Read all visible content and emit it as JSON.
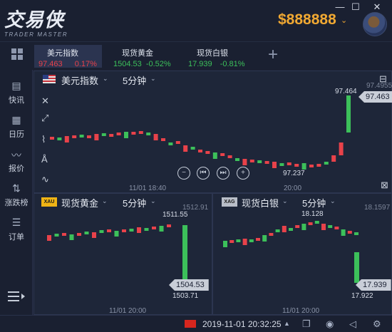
{
  "app": {
    "logo_cn": "交易侠",
    "logo_en": "TRADER MASTER",
    "balance": "$888888",
    "window_controls": {
      "minimize": "—",
      "maximize": "☐",
      "close": "✕"
    }
  },
  "tickers": [
    {
      "name": "美元指数",
      "price": "97.463",
      "change": "0.17%",
      "color": "#e8424a",
      "active": true
    },
    {
      "name": "现货黄金",
      "price": "1504.53",
      "change": "-0.52%",
      "color": "#3cc05a",
      "active": false
    },
    {
      "name": "现货白银",
      "price": "17.939",
      "change": "-0.81%",
      "color": "#3cc05a",
      "active": false
    }
  ],
  "sidebar": {
    "items": [
      {
        "label": "快讯",
        "icon": "news-icon"
      },
      {
        "label": "日历",
        "icon": "calendar-icon"
      },
      {
        "label": "报价",
        "icon": "quote-icon"
      },
      {
        "label": "涨跌榜",
        "icon": "ranking-icon"
      },
      {
        "label": "订单",
        "icon": "order-icon"
      }
    ]
  },
  "main_chart": {
    "symbol": "美元指数",
    "interval": "5分钟",
    "top_price": "97.4955",
    "current_price": "97.463",
    "high_label": "97.464",
    "low_label": "97.237",
    "times": [
      "11/01 18:40",
      "20:00"
    ]
  },
  "gold_chart": {
    "badge": "XAU",
    "symbol": "现货黄金",
    "interval": "5分钟",
    "top_price": "1512.91",
    "current_price": "1504.53",
    "high_label": "1511.55",
    "low_label": "1503.71",
    "times": [
      "11/01 20:00"
    ]
  },
  "silver_chart": {
    "badge": "XAG",
    "symbol": "现货白银",
    "interval": "5分钟",
    "top_price": "18.1597",
    "current_price": "17.939",
    "high_label": "18.128",
    "low_label": "17.922",
    "times": [
      "11/01 20:00"
    ]
  },
  "status": {
    "datetime": "2019-11-01 20:32:25",
    "chevron": "▲"
  },
  "colors": {
    "up": "#e8424a",
    "down": "#3cc05a",
    "accent": "#f0a832"
  }
}
